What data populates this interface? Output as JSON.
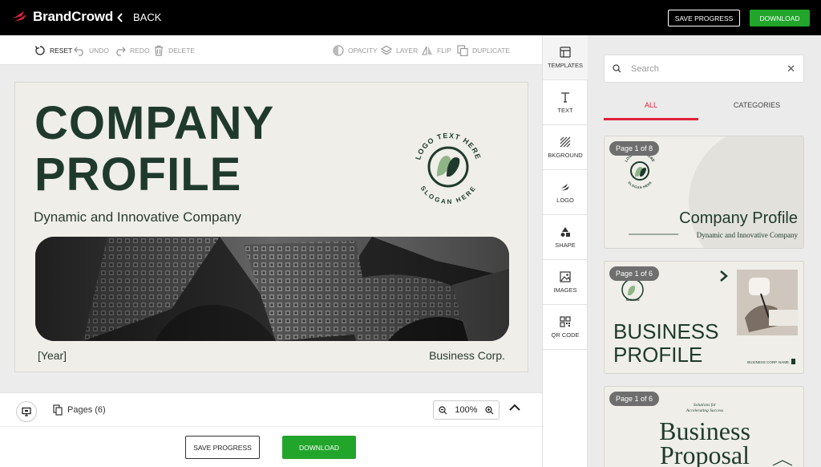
{
  "app": {
    "brand": "BrandCrowd",
    "back_label": "BACK",
    "save_progress": "SAVE PROGRESS",
    "download": "DOWNLOAD"
  },
  "toolbar": {
    "reset": "RESET",
    "undo": "UNDO",
    "redo": "REDO",
    "delete": "DELETE",
    "opacity": "OPACITY",
    "layer": "LAYER",
    "flip": "FLIP",
    "duplicate": "DUPLICATE"
  },
  "canvas": {
    "title_line1": "COMPANY",
    "title_line2": "PROFILE",
    "subtitle": "Dynamic and Innovative Company",
    "logo_text_top": "LOGO TEXT HERE",
    "logo_text_bottom": "SLOGAN HERE",
    "year": "[Year]",
    "corp": "Business Corp.",
    "title_color": "#1f3a2c",
    "background_color": "#efeee8"
  },
  "bottombar": {
    "pages_label": "Pages (6)",
    "zoom": "100%"
  },
  "side_tabs": [
    {
      "label": "TEMPLATES",
      "icon": "templates-icon"
    },
    {
      "label": "TEXT",
      "icon": "text-icon"
    },
    {
      "label": "BKGROUND",
      "icon": "background-icon"
    },
    {
      "label": "LOGO",
      "icon": "logo-icon"
    },
    {
      "label": "SHAPE",
      "icon": "shape-icon"
    },
    {
      "label": "IMAGES",
      "icon": "images-icon"
    },
    {
      "label": "QR CODE",
      "icon": "qr-code-icon"
    }
  ],
  "panel": {
    "search_placeholder": "Search",
    "tab_all": "ALL",
    "tab_categories": "CATEGORIES",
    "cards": [
      {
        "pill": "Page 1 of 8",
        "title": "Company Profile",
        "subtitle": "Dynamic and Innovative Company",
        "badge_top": "LOGO TEXT HERE",
        "badge_bottom": "SLOGAN HERE"
      },
      {
        "pill": "Page 1 of 6",
        "title_line1": "BUSINESS",
        "title_line2": "PROFILE",
        "footer": "BUSINESS CORP. NAME",
        "badge_top": "LOGO",
        "badge_bottom": "SLOGAN"
      },
      {
        "pill": "Page 1 of 6",
        "tagline_line1": "Solutions for",
        "tagline_line2": "Accelerating Success",
        "title_line1": "Business",
        "title_line2": "Proposal"
      }
    ]
  },
  "colors": {
    "accent_green": "#22a52b",
    "tab_red": "#e0223a",
    "brand_red": "#e0223a"
  }
}
